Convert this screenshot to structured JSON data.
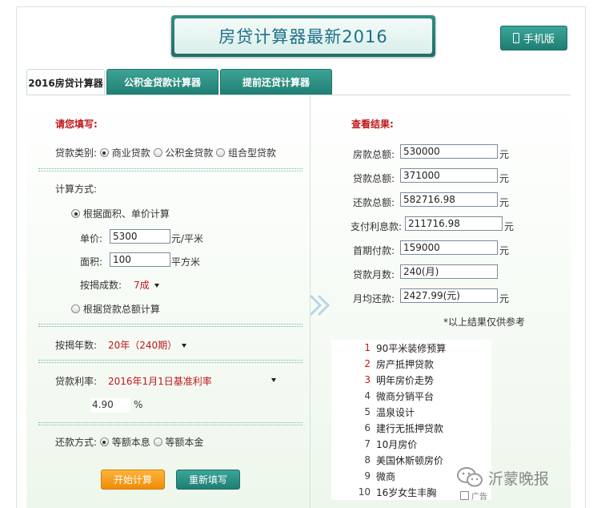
{
  "header": {
    "title": "房贷计算器最新2016",
    "mobile_label": "手机版"
  },
  "tabs": [
    {
      "label": "2016房贷计算器"
    },
    {
      "label": "公积金贷款计算器"
    },
    {
      "label": "提前还贷计算器"
    }
  ],
  "form": {
    "section_title": "请您填写:",
    "loan_type_label": "贷款类别:",
    "loan_types": [
      "商业贷款",
      "公积金贷款",
      "组合型贷款"
    ],
    "calc_method_label": "计算方式:",
    "method_area_label": "根据面积、单价计算",
    "price_label": "单价:",
    "price_value": "5300",
    "price_unit": "元/平米",
    "area_label": "面积:",
    "area_value": "100",
    "area_unit": "平方米",
    "ratio_label": "按揭成数:",
    "ratio_value": "7成",
    "method_total_label": "根据贷款总额计算",
    "years_label": "按揭年数:",
    "years_value": "20年（240期）",
    "rate_label": "贷款利率:",
    "rate_value": "2016年1月1日基准利率",
    "rate_number": "4.90",
    "rate_unit": "%",
    "repay_label": "还款方式:",
    "repay_options": [
      "等额本息",
      "等额本金"
    ],
    "start_button": "开始计算",
    "reset_button": "重新填写"
  },
  "results": {
    "section_title": "查看结果:",
    "rows": [
      {
        "label": "房款总额:",
        "value": "530000",
        "unit": "元"
      },
      {
        "label": "贷款总额:",
        "value": "371000",
        "unit": "元"
      },
      {
        "label": "还款总额:",
        "value": "582716.98",
        "unit": "元"
      },
      {
        "label": "支付利息款:",
        "value": "211716.98",
        "unit": "元"
      },
      {
        "label": "首期付款:",
        "value": "159000",
        "unit": "元"
      },
      {
        "label": "贷款月数:",
        "value": "240(月)",
        "unit": ""
      },
      {
        "label": "月均还款:",
        "value": "2427.99(元)",
        "unit": "元"
      }
    ],
    "note": "*以上结果仅供参考"
  },
  "links": [
    {
      "num": "1",
      "text": "90平米装修预算"
    },
    {
      "num": "2",
      "text": "房产抵押贷款"
    },
    {
      "num": "3",
      "text": "明年房价走势"
    },
    {
      "num": "4",
      "text": "微商分销平台"
    },
    {
      "num": "5",
      "text": "温泉设计"
    },
    {
      "num": "6",
      "text": "建行无抵押贷款"
    },
    {
      "num": "7",
      "text": "10月房价"
    },
    {
      "num": "8",
      "text": "美国休斯顿房价"
    },
    {
      "num": "9",
      "text": "微商"
    },
    {
      "num": "10",
      "text": "16岁女生丰胸"
    }
  ],
  "watermark": {
    "text": "沂蒙晚报",
    "ad_label": "广告"
  }
}
